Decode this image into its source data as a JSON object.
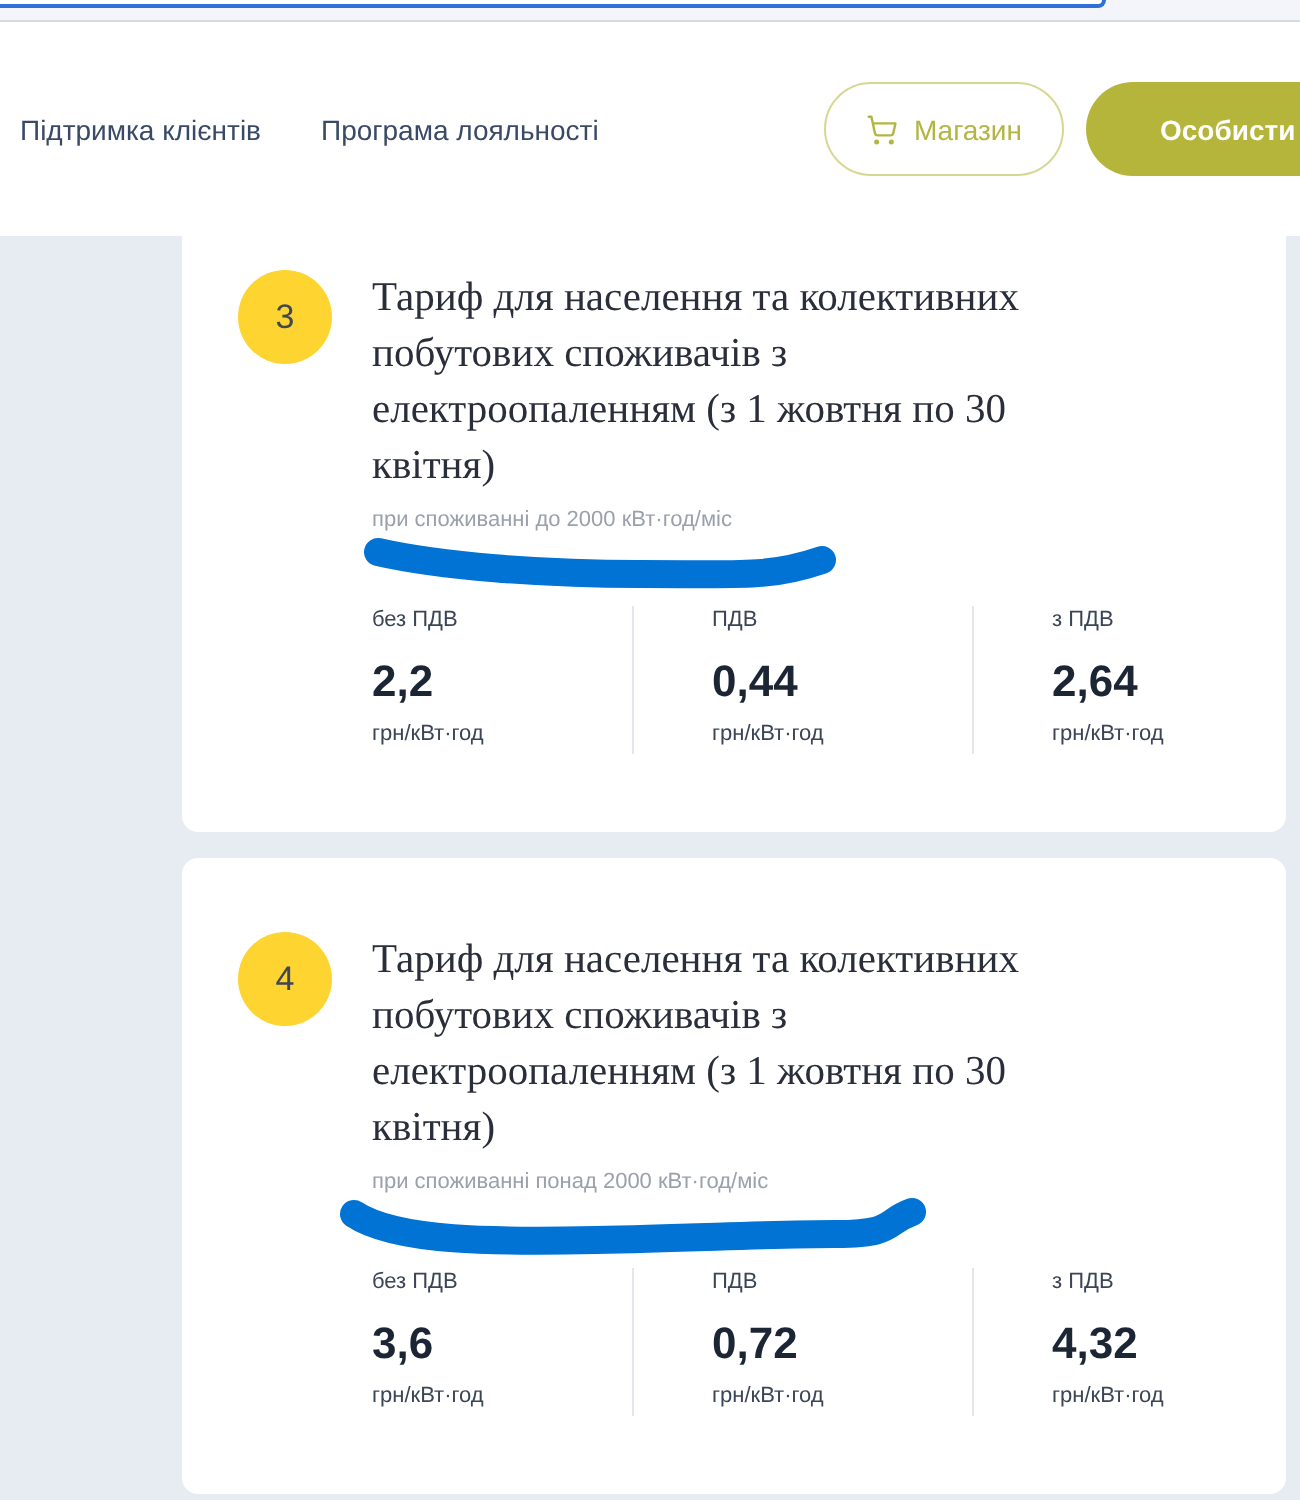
{
  "nav": {
    "links": [
      "Підтримка клієнтів",
      "Програма лояльності"
    ],
    "buttons": [
      {
        "label": "Магазин",
        "kind": "outline"
      },
      {
        "label": "Особисти",
        "kind": "filled"
      }
    ]
  },
  "tariffs": [
    {
      "number": "3",
      "title": "Тариф для населення та колективних побутових споживачів з електроопаленням (з 1 жовтня по 30 квітня)",
      "note": "при споживанні до 2000 кВт·год/міс",
      "underlined": true,
      "prices": [
        {
          "label": "без ПДВ",
          "value": "2,2",
          "unit": "грн/кВт·год"
        },
        {
          "label": "ПДВ",
          "value": "0,44",
          "unit": "грн/кВт·год"
        },
        {
          "label": "з ПДВ",
          "value": "2,64",
          "unit": "грн/кВт·год"
        }
      ]
    },
    {
      "number": "4",
      "title": "Тариф для населення та колективних побутових споживачів з електроопаленням (з 1 жовтня по 30 квітня)",
      "note": "при споживанні понад 2000 кВт·год/міс",
      "underlined": true,
      "prices": [
        {
          "label": "без ПДВ",
          "value": "3,6",
          "unit": "грн/кВт·год"
        },
        {
          "label": "ПДВ",
          "value": "0,72",
          "unit": "грн/кВт·год"
        },
        {
          "label": "з ПДВ",
          "value": "4,32",
          "unit": "грн/кВт·год"
        }
      ]
    }
  ]
}
